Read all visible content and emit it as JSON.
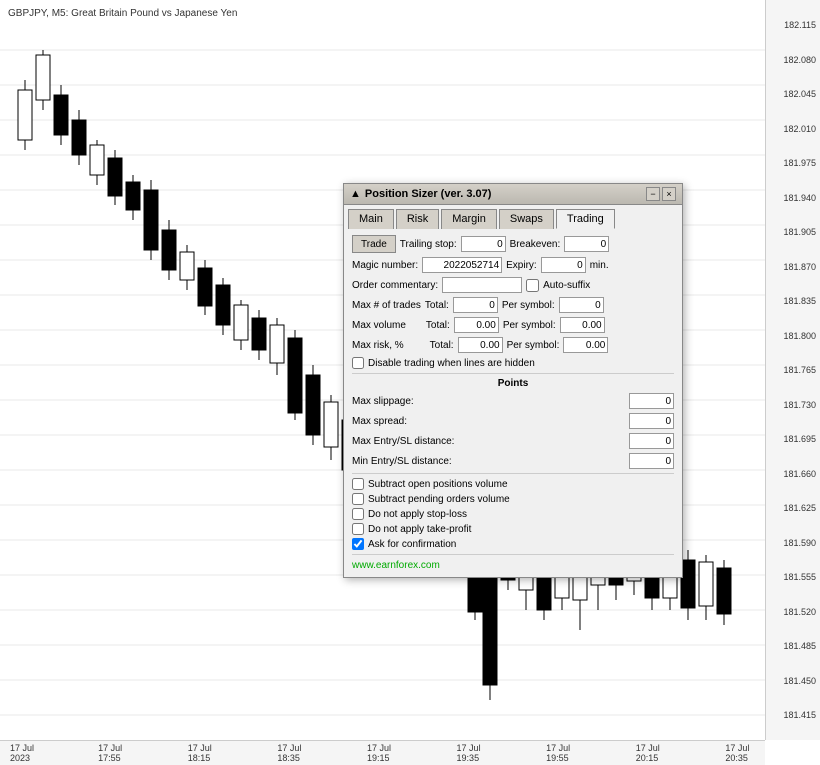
{
  "chart": {
    "title": "GBPJPY, M5: Great Britain Pound vs Japanese Yen",
    "position_sizer_label": "Position Sizer",
    "prices": [
      "182.115",
      "182.080",
      "182.045",
      "182.010",
      "181.975",
      "181.940",
      "181.905",
      "181.870",
      "181.835",
      "181.800",
      "181.765",
      "181.730",
      "181.695",
      "181.660",
      "181.625",
      "181.590",
      "181.555",
      "181.520",
      "181.485",
      "181.450",
      "181.415"
    ],
    "times": [
      "17 Jul 2023",
      "17 Jul 17:55",
      "17 Jul 18:15",
      "17 Jul 18:35",
      "17 Jul 19:15",
      "17 Jul 19:35",
      "17 Jul 19:55",
      "17 Jul 20:15",
      "17 Jul 20:35"
    ]
  },
  "dialog": {
    "title": "Position Sizer (ver. 3.07)",
    "minimize_label": "−",
    "close_label": "×",
    "tabs": [
      "Main",
      "Risk",
      "Margin",
      "Swaps",
      "Trading"
    ],
    "active_tab": "Trading",
    "trade_button": "Trade",
    "trailing_stop_label": "Trailing stop:",
    "trailing_stop_value": "0",
    "breakeven_label": "Breakeven:",
    "breakeven_value": "0",
    "magic_number_label": "Magic number:",
    "magic_number_value": "2022052714",
    "expiry_label": "Expiry:",
    "expiry_value": "0",
    "expiry_unit": "min.",
    "order_commentary_label": "Order commentary:",
    "order_commentary_value": "",
    "auto_suffix_label": "Auto-suffix",
    "auto_suffix_checked": false,
    "max_trades_label": "Max # of trades",
    "max_trades_total_label": "Total:",
    "max_trades_total_value": "0",
    "max_trades_per_symbol_label": "Per symbol:",
    "max_trades_per_symbol_value": "0",
    "max_volume_label": "Max volume",
    "max_volume_total_label": "Total:",
    "max_volume_total_value": "0.00",
    "max_volume_per_symbol_label": "Per symbol:",
    "max_volume_per_symbol_value": "0.00",
    "max_risk_label": "Max risk, %",
    "max_risk_total_label": "Total:",
    "max_risk_total_value": "0.00",
    "max_risk_per_symbol_label": "Per symbol:",
    "max_risk_per_symbol_value": "0.00",
    "disable_trading_label": "Disable trading when lines are hidden",
    "disable_trading_checked": false,
    "points_section": "Points",
    "max_slippage_label": "Max slippage:",
    "max_slippage_value": "0",
    "max_spread_label": "Max spread:",
    "max_spread_value": "0",
    "max_entry_sl_label": "Max Entry/SL distance:",
    "max_entry_sl_value": "0",
    "min_entry_sl_label": "Min Entry/SL distance:",
    "min_entry_sl_value": "0",
    "subtract_open_label": "Subtract open positions volume",
    "subtract_open_checked": false,
    "subtract_pending_label": "Subtract pending orders volume",
    "subtract_pending_checked": false,
    "do_not_apply_sl_label": "Do not apply stop-loss",
    "do_not_apply_sl_checked": false,
    "do_not_apply_tp_label": "Do not apply take-profit",
    "do_not_apply_tp_checked": false,
    "ask_confirmation_label": "Ask for confirmation",
    "ask_confirmation_checked": true,
    "earnforex_url": "www.earnforex.com"
  }
}
